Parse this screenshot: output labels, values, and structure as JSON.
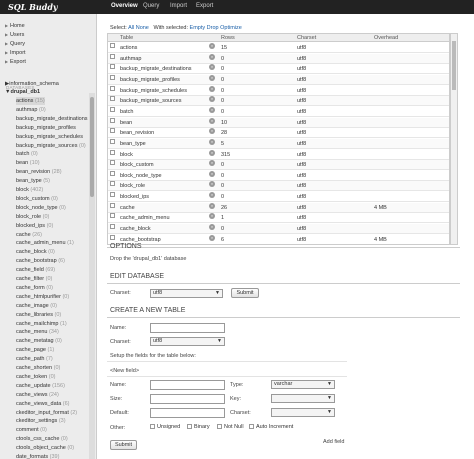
{
  "app": {
    "logo": "SQL Buddy"
  },
  "topnav": [
    "Overview",
    "Query",
    "Import",
    "Export"
  ],
  "sidebar": {
    "items": [
      {
        "label": "Home"
      },
      {
        "label": "Users"
      },
      {
        "label": "Query"
      },
      {
        "label": "Import"
      },
      {
        "label": "Export"
      }
    ],
    "databases_label": "DATABASES",
    "databases": [
      {
        "name": "information_schema"
      },
      {
        "name": "drupal_db1"
      }
    ],
    "tables": [
      {
        "name": "actions",
        "count": "(15)"
      },
      {
        "name": "authmap",
        "count": "(0)"
      },
      {
        "name": "backup_migrate_destinations",
        "count": ""
      },
      {
        "name": "backup_migrate_profiles",
        "count": ""
      },
      {
        "name": "backup_migrate_schedules",
        "count": ""
      },
      {
        "name": "backup_migrate_sources",
        "count": "(0)"
      },
      {
        "name": "batch",
        "count": "(0)"
      },
      {
        "name": "bean",
        "count": "(10)"
      },
      {
        "name": "bean_revision",
        "count": "(28)"
      },
      {
        "name": "bean_type",
        "count": "(5)"
      },
      {
        "name": "block",
        "count": "(402)"
      },
      {
        "name": "block_custom",
        "count": "(0)"
      },
      {
        "name": "block_node_type",
        "count": "(0)"
      },
      {
        "name": "block_role",
        "count": "(0)"
      },
      {
        "name": "blocked_ips",
        "count": "(0)"
      },
      {
        "name": "cache",
        "count": "(26)"
      },
      {
        "name": "cache_admin_menu",
        "count": "(1)"
      },
      {
        "name": "cache_block",
        "count": "(0)"
      },
      {
        "name": "cache_bootstrap",
        "count": "(6)"
      },
      {
        "name": "cache_field",
        "count": "(69)"
      },
      {
        "name": "cache_filter",
        "count": "(0)"
      },
      {
        "name": "cache_form",
        "count": "(0)"
      },
      {
        "name": "cache_htmlpurifier",
        "count": "(0)"
      },
      {
        "name": "cache_image",
        "count": "(0)"
      },
      {
        "name": "cache_libraries",
        "count": "(0)"
      },
      {
        "name": "cache_mailchimp",
        "count": "(1)"
      },
      {
        "name": "cache_menu",
        "count": "(34)"
      },
      {
        "name": "cache_metatag",
        "count": "(0)"
      },
      {
        "name": "cache_page",
        "count": "(1)"
      },
      {
        "name": "cache_path",
        "count": "(7)"
      },
      {
        "name": "cache_shorten",
        "count": "(0)"
      },
      {
        "name": "cache_token",
        "count": "(0)"
      },
      {
        "name": "cache_update",
        "count": "(156)"
      },
      {
        "name": "cache_views",
        "count": "(24)"
      },
      {
        "name": "cache_views_data",
        "count": "(6)"
      },
      {
        "name": "ckeditor_input_format",
        "count": "(2)"
      },
      {
        "name": "ckeditor_settings",
        "count": "(3)"
      },
      {
        "name": "comment",
        "count": "(0)"
      },
      {
        "name": "ctools_css_cache",
        "count": "(0)"
      },
      {
        "name": "ctools_object_cache",
        "count": "(0)"
      },
      {
        "name": "date_formats",
        "count": "(39)"
      },
      {
        "name": "date_format_locale",
        "count": "(0)"
      },
      {
        "name": "date_format_type",
        "count": "(7)"
      }
    ]
  },
  "selection": {
    "select_label": "Select:",
    "all": "All",
    "none": "None",
    "with_selected": "With selected:",
    "empty": "Empty",
    "drop": "Drop",
    "optimize": "Optimize"
  },
  "grid": {
    "columns": [
      "Table",
      "Rows",
      "Charset",
      "Overhead"
    ],
    "rows": [
      {
        "table": "actions",
        "rows": "15",
        "charset": "utf8",
        "overhead": ""
      },
      {
        "table": "authmap",
        "rows": "0",
        "charset": "utf8",
        "overhead": ""
      },
      {
        "table": "backup_migrate_destinations",
        "rows": "0",
        "charset": "utf8",
        "overhead": ""
      },
      {
        "table": "backup_migrate_profiles",
        "rows": "0",
        "charset": "utf8",
        "overhead": ""
      },
      {
        "table": "backup_migrate_schedules",
        "rows": "0",
        "charset": "utf8",
        "overhead": ""
      },
      {
        "table": "backup_migrate_sources",
        "rows": "0",
        "charset": "utf8",
        "overhead": ""
      },
      {
        "table": "batch",
        "rows": "0",
        "charset": "utf8",
        "overhead": ""
      },
      {
        "table": "bean",
        "rows": "10",
        "charset": "utf8",
        "overhead": ""
      },
      {
        "table": "bean_revision",
        "rows": "28",
        "charset": "utf8",
        "overhead": ""
      },
      {
        "table": "bean_type",
        "rows": "5",
        "charset": "utf8",
        "overhead": ""
      },
      {
        "table": "block",
        "rows": "315",
        "charset": "utf8",
        "overhead": ""
      },
      {
        "table": "block_custom",
        "rows": "0",
        "charset": "utf8",
        "overhead": ""
      },
      {
        "table": "block_node_type",
        "rows": "0",
        "charset": "utf8",
        "overhead": ""
      },
      {
        "table": "block_role",
        "rows": "0",
        "charset": "utf8",
        "overhead": ""
      },
      {
        "table": "blocked_ips",
        "rows": "0",
        "charset": "utf8",
        "overhead": ""
      },
      {
        "table": "cache",
        "rows": "26",
        "charset": "utf8",
        "overhead": "4 MB"
      },
      {
        "table": "cache_admin_menu",
        "rows": "1",
        "charset": "utf8",
        "overhead": ""
      },
      {
        "table": "cache_block",
        "rows": "0",
        "charset": "utf8",
        "overhead": ""
      },
      {
        "table": "cache_bootstrap",
        "rows": "6",
        "charset": "utf8",
        "overhead": "4 MB"
      }
    ]
  },
  "options": {
    "title": "OPTIONS",
    "drop_link": "Drop the 'drupal_db1' database"
  },
  "edit_db": {
    "title": "EDIT DATABASE",
    "charset_label": "Charset:",
    "charset_value": "utf8",
    "submit": "Submit"
  },
  "create_table": {
    "title": "CREATE A NEW TABLE",
    "name_label": "Name:",
    "charset_label": "Charset:",
    "charset_value": "utf8",
    "setup_text": "Setup the fields for the table below:",
    "new_field": "<New field>",
    "field_name_label": "Name:",
    "type_label": "Type:",
    "type_value": "varchar",
    "size_label": "Size:",
    "key_label": "Key:",
    "default_label": "Default:",
    "field_charset_label": "Charset:",
    "other_label": "Other:",
    "unsigned": "Unsigned",
    "binary": "Binary",
    "not_null": "Not Null",
    "auto_increment": "Auto Increment",
    "add_field": "Add field",
    "submit": "Submit"
  }
}
